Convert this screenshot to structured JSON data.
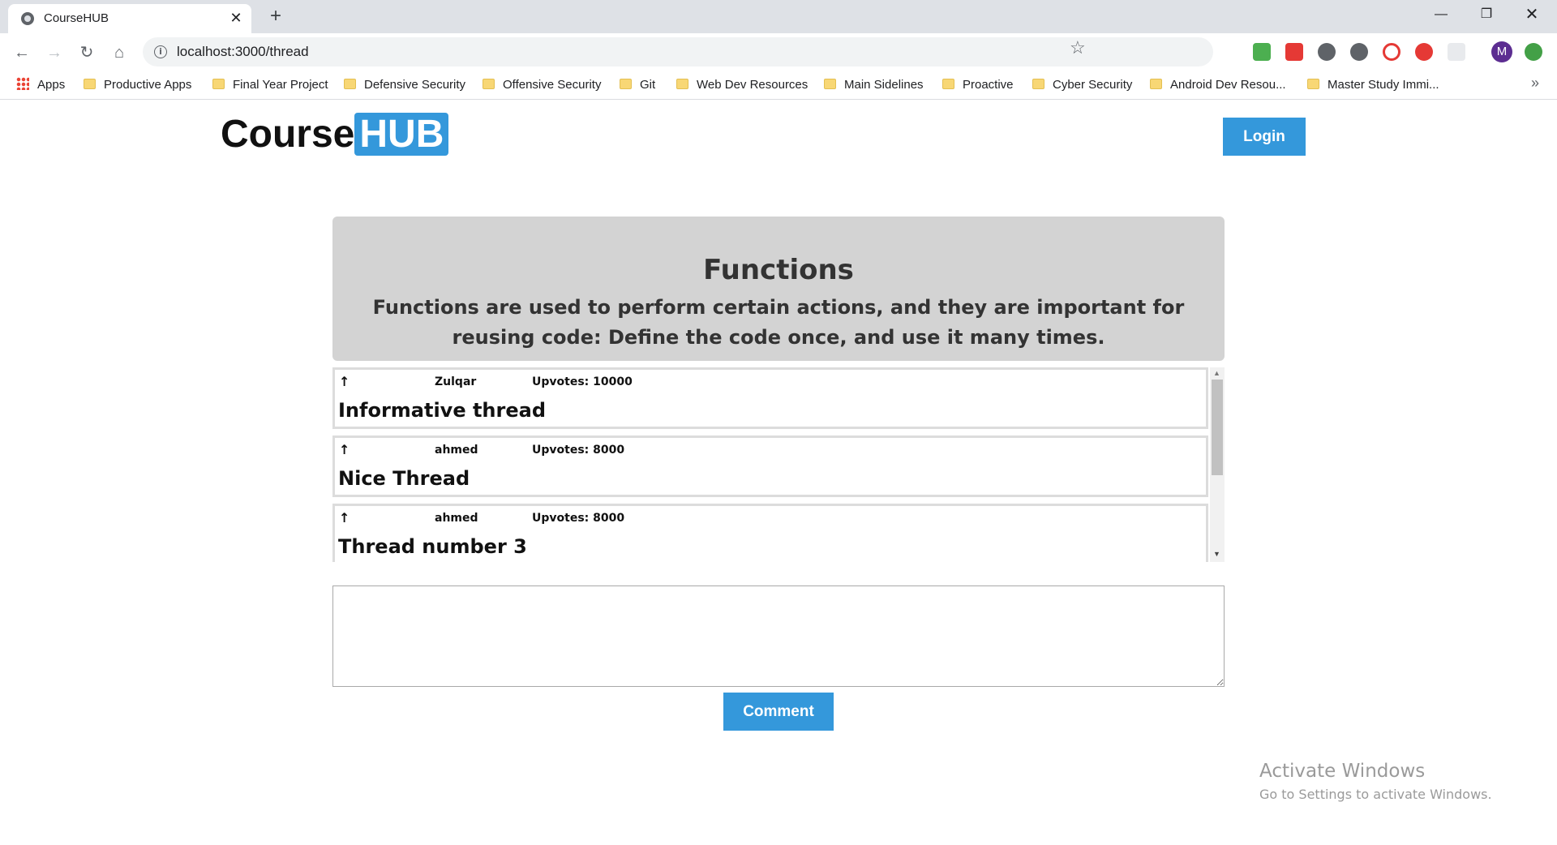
{
  "browser": {
    "tab_title": "CourseHUB",
    "url": "localhost:3000/thread",
    "profile_initial": "M",
    "bookmarks": [
      "Apps",
      "Productive Apps",
      "Final Year Project",
      "Defensive Security",
      "Offensive Security",
      "Git",
      "Web Dev Resources",
      "Main Sidelines",
      "Proactive",
      "Cyber Security",
      "Android Dev Resou...",
      "Master Study Immi..."
    ],
    "extension_icons": [
      "check-extension-icon",
      "dots-extension-icon",
      "cloud-extension-icon",
      "cloud-download-extension-icon",
      "circle-extension-icon",
      "yab-extension-icon",
      "gitzip-extension-icon",
      "green-upload-extension-icon"
    ]
  },
  "header": {
    "logo_course": "Course",
    "logo_hub": "HUB",
    "login_label": "Login"
  },
  "topic": {
    "title": "Functions",
    "description": "Functions are used to perform certain actions, and they are important for reusing code: Define the code once, and use it many times."
  },
  "threads": [
    {
      "author": "Zulqar",
      "upvotes": "Upvotes: 10000",
      "title": "Informative thread"
    },
    {
      "author": "ahmed",
      "upvotes": "Upvotes: 8000",
      "title": "Nice Thread"
    },
    {
      "author": "ahmed",
      "upvotes": "Upvotes: 8000",
      "title": "Thread number 3"
    }
  ],
  "comment": {
    "value": "",
    "button_label": "Comment"
  },
  "watermark": {
    "title": "Activate Windows",
    "subtitle": "Go to Settings to activate Windows."
  },
  "colors": {
    "accent": "#3498db",
    "hero_bg": "#d3d3d3",
    "card_border": "#dcdcdc"
  }
}
